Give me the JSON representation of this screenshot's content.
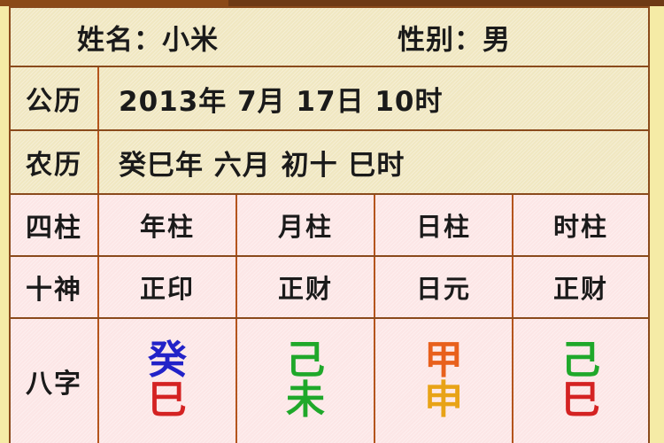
{
  "header": {
    "name_label": "姓名",
    "name_value": "小米",
    "name_text": "姓名：小米",
    "gender_label": "性别",
    "gender_value": "男",
    "gender_text": "性别：男"
  },
  "rows": {
    "solar": {
      "label": "公历",
      "value": "2013年 7月 17日 10时",
      "year": "2013年",
      "month": "7月",
      "day": "17日",
      "hour": "10时"
    },
    "lunar": {
      "label": "农历",
      "value": "癸巳年 六月 初十 巳时",
      "year": "癸巳年",
      "month": "六月",
      "day": "初十",
      "hour": "巳时"
    },
    "pillars": {
      "label": "四柱",
      "values": [
        "年柱",
        "月柱",
        "日柱",
        "时柱"
      ]
    },
    "ten_gods": {
      "label": "十神",
      "values": [
        "正印",
        "正财",
        "日元",
        "正财"
      ]
    },
    "bazi": {
      "label": "八字",
      "pillars": [
        {
          "stem": "癸",
          "stem_color": "#2222C8",
          "branch": "巳",
          "branch_color": "#D42222"
        },
        {
          "stem": "己",
          "stem_color": "#1FA82A",
          "branch": "未",
          "branch_color": "#1FA82A"
        },
        {
          "stem": "甲",
          "stem_color": "#E8601C",
          "branch": "申",
          "branch_color": "#E8A317"
        },
        {
          "stem": "己",
          "stem_color": "#1FA82A",
          "branch": "巳",
          "branch_color": "#D42222"
        }
      ]
    }
  },
  "colors": {
    "page_edge": "#F5EBA6",
    "top_bar_left": "#8B4A18",
    "top_bar_right": "#6E3A15",
    "frame_border": "#8A4A1C",
    "inner_divider": "#B4541C",
    "cream_bg": "#F0E7C1",
    "pink_bg": "#FCE6E6",
    "text": "#1A1A1A"
  }
}
